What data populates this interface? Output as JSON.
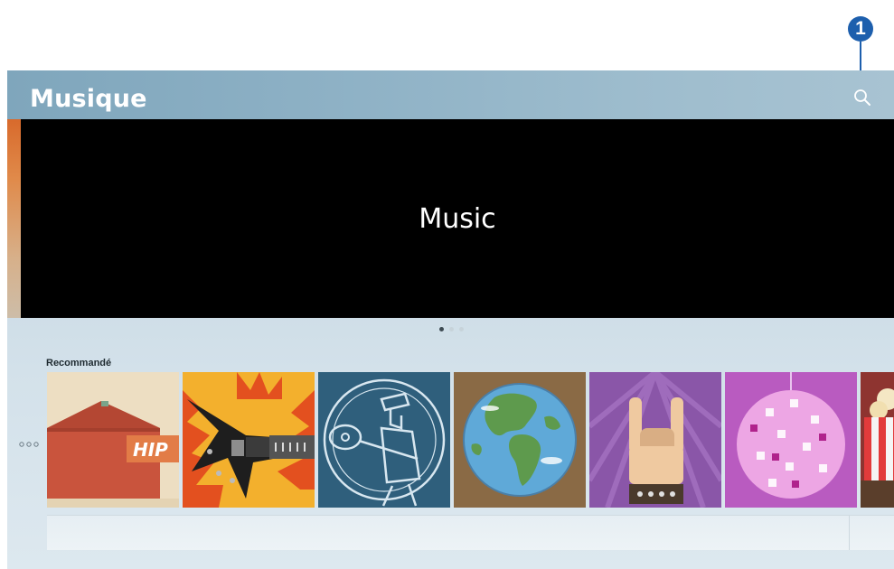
{
  "header": {
    "title": "Musique"
  },
  "hero": {
    "title": "Music"
  },
  "carousel": {
    "page_count": 3,
    "active_index": 0
  },
  "recommended": {
    "label": "Recommandé",
    "tiles": [
      {
        "name": "hip-hop",
        "text": "HIP"
      },
      {
        "name": "rock-guitar"
      },
      {
        "name": "blues-guitarist"
      },
      {
        "name": "world-globe"
      },
      {
        "name": "rock-hand"
      },
      {
        "name": "disco-ball"
      },
      {
        "name": "popcorn"
      }
    ]
  },
  "annotation": {
    "number": "1"
  },
  "colors": {
    "header_bg": "#8fb2c6",
    "hero_bg": "#000000",
    "callout": "#1d5fad"
  }
}
